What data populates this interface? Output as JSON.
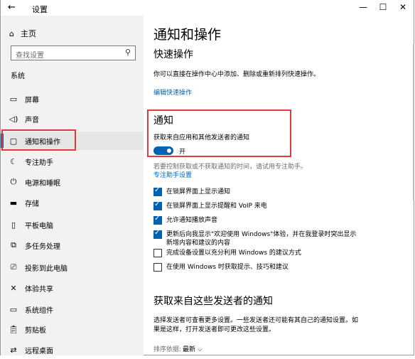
{
  "window": {
    "title": "设置",
    "back_icon": "back-arrow-icon",
    "controls": [
      "minimize-icon",
      "maximize-icon",
      "close-icon"
    ]
  },
  "sidebar": {
    "home_label": "主页",
    "search_placeholder": "查找设置",
    "section_label": "系统",
    "items": [
      {
        "label": "屏幕",
        "icon": "display-icon"
      },
      {
        "label": "声音",
        "icon": "sound-icon"
      },
      {
        "label": "通知和操作",
        "icon": "notification-icon",
        "active": true
      },
      {
        "label": "专注助手",
        "icon": "moon-icon"
      },
      {
        "label": "电源和睡眠",
        "icon": "power-icon"
      },
      {
        "label": "存储",
        "icon": "storage-icon"
      },
      {
        "label": "平板电脑",
        "icon": "tablet-icon"
      },
      {
        "label": "多任务处理",
        "icon": "multitask-icon"
      },
      {
        "label": "投影到此电脑",
        "icon": "project-icon"
      },
      {
        "label": "体验共享",
        "icon": "share-icon"
      },
      {
        "label": "系统组件",
        "icon": "components-icon"
      },
      {
        "label": "剪贴板",
        "icon": "clipboard-icon"
      },
      {
        "label": "远程桌面",
        "icon": "remote-desktop-icon"
      }
    ]
  },
  "main": {
    "title": "通知和操作",
    "quick_actions": {
      "heading": "快速操作",
      "description": "你可以直接在操作中心中添加、删除或重新排列快速操作。",
      "link": "编辑快速操作"
    },
    "notifications": {
      "heading": "通知",
      "toggle_label": "获取来自应用和其他发送者的通知",
      "toggle_state": "开",
      "focus_hint": "若要控制获取或不获取通知的时间，请试用专注助手。",
      "focus_link": "专注助手设置",
      "checkboxes": [
        {
          "label": "在锁屏界面上显示通知",
          "checked": true
        },
        {
          "label": "在锁屏界面上显示提醒和 VoIP 来电",
          "checked": true
        },
        {
          "label": "允许通知播放声音",
          "checked": true
        },
        {
          "label": "更新后向我显示\"欢迎使用 Windows\"体验，并在我登录时突出显示",
          "label2": "新增内容和建议的内容",
          "checked": true
        },
        {
          "label": "完成设备设置以充分利用 Windows 的建议方式",
          "checked": false
        },
        {
          "label": "在使用 Windows 时获取提示、技巧和建议",
          "checked": false
        }
      ]
    },
    "senders": {
      "heading": "获取来自这些发送者的通知",
      "description1": "选择发送者可查看更多设置。一些发送者还可能有其自己的通知设置。如",
      "description2": "果是这样，打开发送者即可更改这些设置。",
      "sort_label": "排序依据:",
      "sort_value": "最新"
    }
  }
}
